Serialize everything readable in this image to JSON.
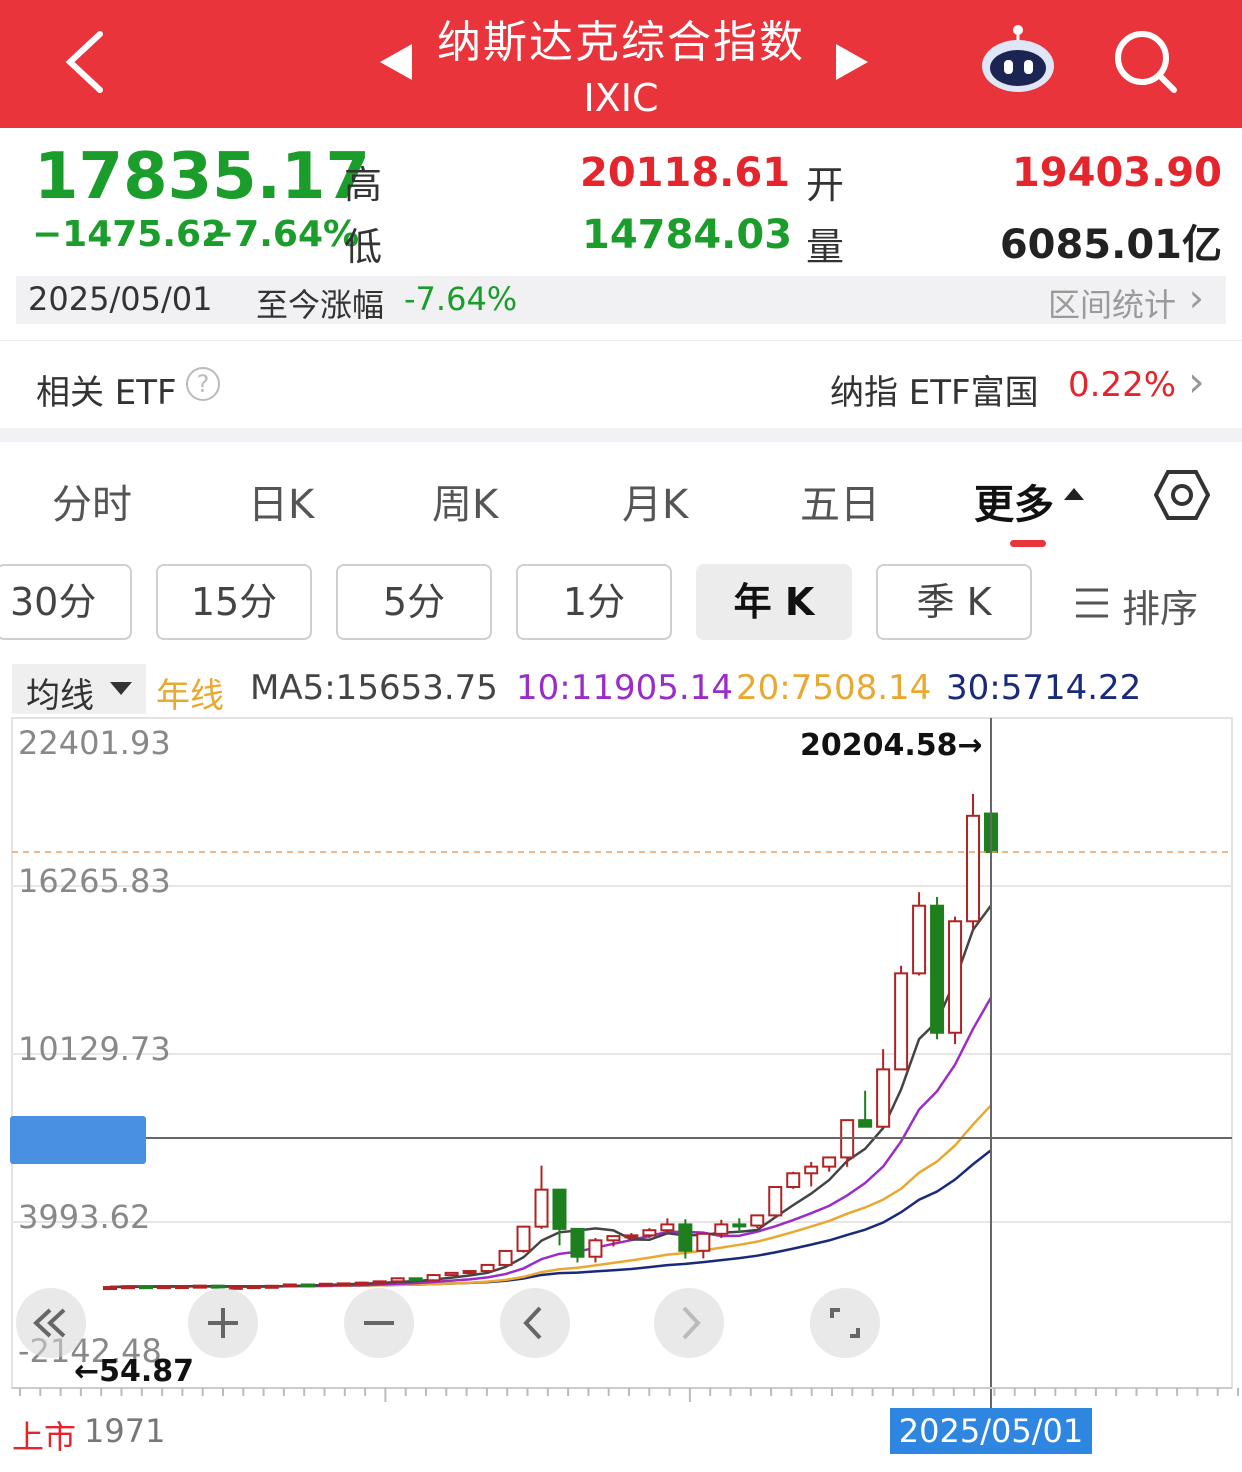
{
  "header": {
    "title": "纳斯达克综合指数",
    "subtitle": "IXIC",
    "colors": {
      "bg": "#e8343a"
    },
    "icons": [
      "back-icon",
      "prev-triangle-icon",
      "next-triangle-icon",
      "robot-assistant-icon",
      "search-icon"
    ]
  },
  "quote": {
    "price": "17835.17",
    "change": "−1475.62",
    "change_pct": "−7.64%",
    "high_label": "高",
    "high": "20118.61",
    "low_label": "低",
    "low": "14784.03",
    "open_label": "开",
    "open": "19403.90",
    "volume_label": "量",
    "volume": "6085.01亿"
  },
  "range_stats": {
    "date": "2025/05/01",
    "label": "至今涨幅",
    "value": "-7.64%",
    "link": "区间统计",
    "link_arrow": "›"
  },
  "etf": {
    "label": "相关 ETF",
    "help_icon": "?",
    "fund": "纳指 ETF富国",
    "fund_change": "0.22%",
    "arrow": "›"
  },
  "tabs": {
    "items": [
      "分时",
      "日K",
      "周K",
      "月K",
      "五日",
      "更多"
    ],
    "active": "更多"
  },
  "periods": {
    "items": [
      "30分",
      "15分",
      "5分",
      "1分",
      "年 K",
      "季 K"
    ],
    "selected": "年 K",
    "sort_label": "排序"
  },
  "indicator": {
    "dropdown": "均线",
    "line_name": "年线",
    "ma5": "MA5:15653.75",
    "ma10": "10:11905.14",
    "ma20": "20:7508.14",
    "ma30": "30:5714.22",
    "colors": {
      "ma5": "#444444",
      "ma10": "#9b2cc8",
      "ma20": "#e9a82f",
      "ma30": "#1a2a7a"
    }
  },
  "chart_data": {
    "type": "candlestick",
    "y_ticks": [
      "22401.93",
      "16265.83",
      "10129.73",
      "3993.62",
      "-2142.48"
    ],
    "ylim": [
      -2142.48,
      22401.93
    ],
    "max_annotation": "20204.58→",
    "min_annotation": "←54.87",
    "listing_label": "上市",
    "listing_year": "1971",
    "cursor_date": "2025/05/01",
    "current_price": 17835.17,
    "up_color": "#b22222",
    "down_color": "#1e7f1e",
    "candles": [
      {
        "o": 95,
        "h": 105,
        "l": 80,
        "c": 98
      },
      {
        "o": 98,
        "h": 135,
        "l": 92,
        "c": 133
      },
      {
        "o": 133,
        "h": 139,
        "l": 110,
        "c": 114
      },
      {
        "o": 114,
        "h": 139,
        "l": 100,
        "c": 136
      },
      {
        "o": 136,
        "h": 147,
        "l": 128,
        "c": 139
      },
      {
        "o": 139,
        "h": 160,
        "l": 130,
        "c": 155
      },
      {
        "o": 155,
        "h": 160,
        "l": 80,
        "c": 83
      },
      {
        "o": 83,
        "h": 114,
        "l": 76,
        "c": 108
      },
      {
        "o": 108,
        "h": 138,
        "l": 107,
        "c": 138
      },
      {
        "o": 138,
        "h": 159,
        "l": 130,
        "c": 150
      },
      {
        "o": 150,
        "h": 210,
        "l": 150,
        "c": 203
      },
      {
        "o": 203,
        "h": 200,
        "l": 150,
        "c": 195
      },
      {
        "o": 195,
        "h": 250,
        "l": 190,
        "c": 232
      },
      {
        "o": 232,
        "h": 279,
        "l": 225,
        "c": 247
      },
      {
        "o": 247,
        "h": 313,
        "l": 246,
        "c": 278
      },
      {
        "o": 278,
        "h": 350,
        "l": 218,
        "c": 330
      },
      {
        "o": 330,
        "h": 460,
        "l": 322,
        "c": 455
      },
      {
        "o": 455,
        "h": 460,
        "l": 350,
        "c": 373
      },
      {
        "o": 373,
        "h": 625,
        "l": 355,
        "c": 586
      },
      {
        "o": 586,
        "h": 700,
        "l": 586,
        "c": 677
      },
      {
        "o": 677,
        "h": 750,
        "l": 600,
        "c": 751
      },
      {
        "o": 751,
        "h": 1000,
        "l": 700,
        "c": 1000
      },
      {
        "o": 1000,
        "h": 1600,
        "l": 1000,
        "c": 1570
      },
      {
        "o": 1570,
        "h": 2600,
        "l": 1500,
        "c": 2560
      },
      {
        "o": 2560,
        "h": 5048,
        "l": 2470,
        "c": 4069
      },
      {
        "o": 4069,
        "h": 4070,
        "l": 1800,
        "c": 2470
      },
      {
        "o": 2470,
        "h": 2500,
        "l": 1100,
        "c": 1335
      },
      {
        "o": 1335,
        "h": 2100,
        "l": 1100,
        "c": 2003
      },
      {
        "o": 2003,
        "h": 2200,
        "l": 1750,
        "c": 2175
      },
      {
        "o": 2175,
        "h": 2300,
        "l": 2000,
        "c": 2205
      },
      {
        "o": 2205,
        "h": 2500,
        "l": 2100,
        "c": 2415
      },
      {
        "o": 2415,
        "h": 2900,
        "l": 2300,
        "c": 2652
      },
      {
        "o": 2652,
        "h": 2862,
        "l": 1260,
        "c": 1577
      },
      {
        "o": 1577,
        "h": 2300,
        "l": 1265,
        "c": 2269
      },
      {
        "o": 2269,
        "h": 2840,
        "l": 2100,
        "c": 2652
      },
      {
        "o": 2652,
        "h": 2900,
        "l": 2298,
        "c": 2605
      },
      {
        "o": 2605,
        "h": 3000,
        "l": 2500,
        "c": 3020
      },
      {
        "o": 3020,
        "h": 4200,
        "l": 2900,
        "c": 4177
      },
      {
        "o": 4177,
        "h": 4800,
        "l": 4100,
        "c": 4736
      },
      {
        "o": 4736,
        "h": 5200,
        "l": 4200,
        "c": 5007
      },
      {
        "o": 5007,
        "h": 5400,
        "l": 4800,
        "c": 5383
      },
      {
        "o": 5383,
        "h": 6900,
        "l": 5000,
        "c": 6903
      },
      {
        "o": 6903,
        "h": 8100,
        "l": 6700,
        "c": 6635
      },
      {
        "o": 6635,
        "h": 9800,
        "l": 6600,
        "c": 8973
      },
      {
        "o": 8973,
        "h": 13200,
        "l": 8950,
        "c": 12888
      },
      {
        "o": 12888,
        "h": 16200,
        "l": 12800,
        "c": 15645
      },
      {
        "o": 15645,
        "h": 16000,
        "l": 10200,
        "c": 10466
      },
      {
        "o": 10466,
        "h": 15200,
        "l": 10000,
        "c": 15011
      },
      {
        "o": 15011,
        "h": 20204,
        "l": 14700,
        "c": 19311
      },
      {
        "o": 19403,
        "h": 20118,
        "l": 14784,
        "c": 17835
      }
    ]
  },
  "controls": {
    "icons": [
      "double-chevron-left-icon",
      "zoom-in-icon",
      "zoom-out-icon",
      "chevron-left-icon",
      "chevron-right-icon",
      "fullscreen-icon"
    ]
  }
}
